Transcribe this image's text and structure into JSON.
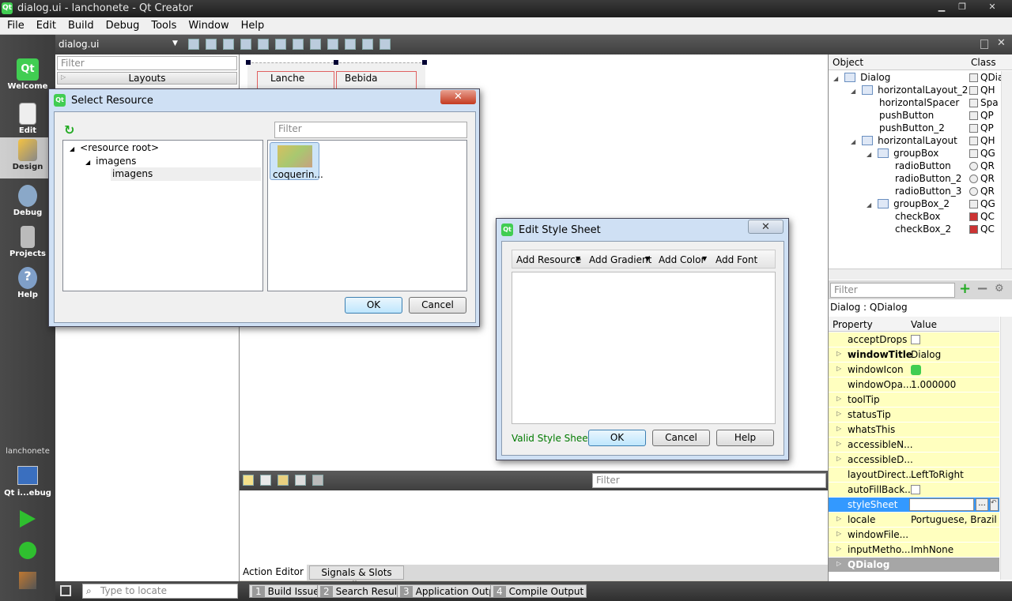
{
  "window": {
    "title": "dialog.ui - lanchonete - Qt Creator",
    "min": "▁",
    "max": "❐",
    "close": "✕"
  },
  "menu": [
    "File",
    "Edit",
    "Build",
    "Debug",
    "Tools",
    "Window",
    "Help"
  ],
  "modes": [
    {
      "label": "Welcome",
      "icon": "qt-logo-icon"
    },
    {
      "label": "Edit",
      "icon": "edit-document-icon"
    },
    {
      "label": "Design",
      "icon": "design-pen-icon"
    },
    {
      "label": "Debug",
      "icon": "debug-bug-icon"
    },
    {
      "label": "Projects",
      "icon": "projects-icon"
    },
    {
      "label": "Help",
      "icon": "help-icon"
    }
  ],
  "kit": {
    "project": "lanchonete",
    "target": "Qt i...ebug"
  },
  "editor": {
    "file": "dialog.ui"
  },
  "widgetbox": {
    "filter_placeholder": "Filter",
    "category": "Layouts"
  },
  "form": {
    "tab1": "Lanche",
    "tab2": "Bebida"
  },
  "select_resource": {
    "title": "Select Resource",
    "filter_placeholder": "Filter",
    "tree": [
      "<resource root>",
      "imagens",
      "imagens"
    ],
    "file": "coquerin...",
    "ok": "OK",
    "cancel": "Cancel"
  },
  "style_sheet": {
    "title": "Edit Style Sheet",
    "add_resource": "Add Resource",
    "add_gradient": "Add Gradient",
    "add_color": "Add Color",
    "add_font": "Add Font",
    "status": "Valid Style Sheet",
    "ok": "OK",
    "cancel": "Cancel",
    "help": "Help",
    "status_color": "#007a00"
  },
  "action_editor": {
    "filter_placeholder": "Filter",
    "tab_action": "Action Editor",
    "tab_signals": "Signals & Slots Editor"
  },
  "object_inspector": {
    "col_object": "Object",
    "col_class": "Class",
    "rows": [
      {
        "name": "Dialog",
        "cls": "QDialo"
      },
      {
        "name": "horizontalLayout_2",
        "cls": "QH"
      },
      {
        "name": "horizontalSpacer",
        "cls": "Spa"
      },
      {
        "name": "pushButton",
        "cls": "QP"
      },
      {
        "name": "pushButton_2",
        "cls": "QP"
      },
      {
        "name": "horizontalLayout",
        "cls": "QH"
      },
      {
        "name": "groupBox",
        "cls": "QG"
      },
      {
        "name": "radioButton",
        "cls": "QR"
      },
      {
        "name": "radioButton_2",
        "cls": "QR"
      },
      {
        "name": "radioButton_3",
        "cls": "QR"
      },
      {
        "name": "groupBox_2",
        "cls": "QG"
      },
      {
        "name": "checkBox",
        "cls": "QC"
      },
      {
        "name": "checkBox_2",
        "cls": "QC"
      }
    ]
  },
  "property_editor": {
    "filter_placeholder": "Filter",
    "object_label": "Dialog : QDialog",
    "col_property": "Property",
    "col_value": "Value",
    "rows": [
      {
        "name": "acceptDrops",
        "value": ""
      },
      {
        "name": "windowTitle",
        "value": "Dialog"
      },
      {
        "name": "windowIcon",
        "value": ""
      },
      {
        "name": "windowOpa...",
        "value": "1.000000"
      },
      {
        "name": "toolTip",
        "value": ""
      },
      {
        "name": "statusTip",
        "value": ""
      },
      {
        "name": "whatsThis",
        "value": ""
      },
      {
        "name": "accessibleN...",
        "value": ""
      },
      {
        "name": "accessibleD...",
        "value": ""
      },
      {
        "name": "layoutDirect...",
        "value": "LeftToRight"
      },
      {
        "name": "autoFillBack...",
        "value": ""
      },
      {
        "name": "styleSheet",
        "value": ""
      },
      {
        "name": "locale",
        "value": "Portuguese, Brazil"
      },
      {
        "name": "windowFile...",
        "value": ""
      },
      {
        "name": "inputMetho...",
        "value": "ImhNone"
      }
    ],
    "section": "QDialog",
    "ellipsis": "..."
  },
  "statusbar": {
    "locate_placeholder": "Type to locate",
    "tabs": [
      {
        "num": "1",
        "label": "Build Issues"
      },
      {
        "num": "2",
        "label": "Search Results"
      },
      {
        "num": "3",
        "label": "Application Output"
      },
      {
        "num": "4",
        "label": "Compile Output"
      }
    ]
  },
  "colors": {
    "property_highlight": "#ffffbf",
    "selection": "#3399ff",
    "qt_green": "#41cd52"
  }
}
